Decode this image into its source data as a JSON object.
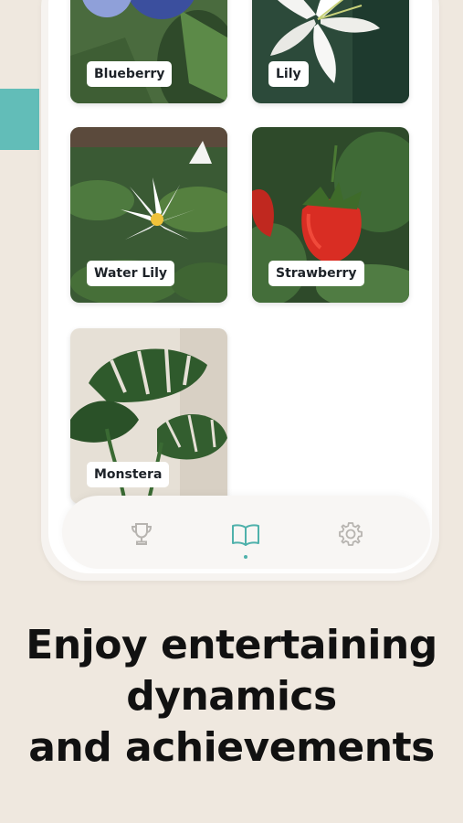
{
  "cards": [
    {
      "label": "Blueberry"
    },
    {
      "label": "Lily"
    },
    {
      "label": "Water Lily"
    },
    {
      "label": "Strawberry"
    },
    {
      "label": "Monstera"
    }
  ],
  "tabbar": {
    "tabs": [
      {
        "icon": "trophy-icon",
        "active": false
      },
      {
        "icon": "book-icon",
        "active": true
      },
      {
        "icon": "gear-icon",
        "active": false
      }
    ],
    "active_color": "#4fb1ab",
    "inactive_color": "#b7b4b0"
  },
  "headline": {
    "line1": "Enjoy entertaining",
    "line2": "dynamics",
    "line3": "and achievements"
  }
}
